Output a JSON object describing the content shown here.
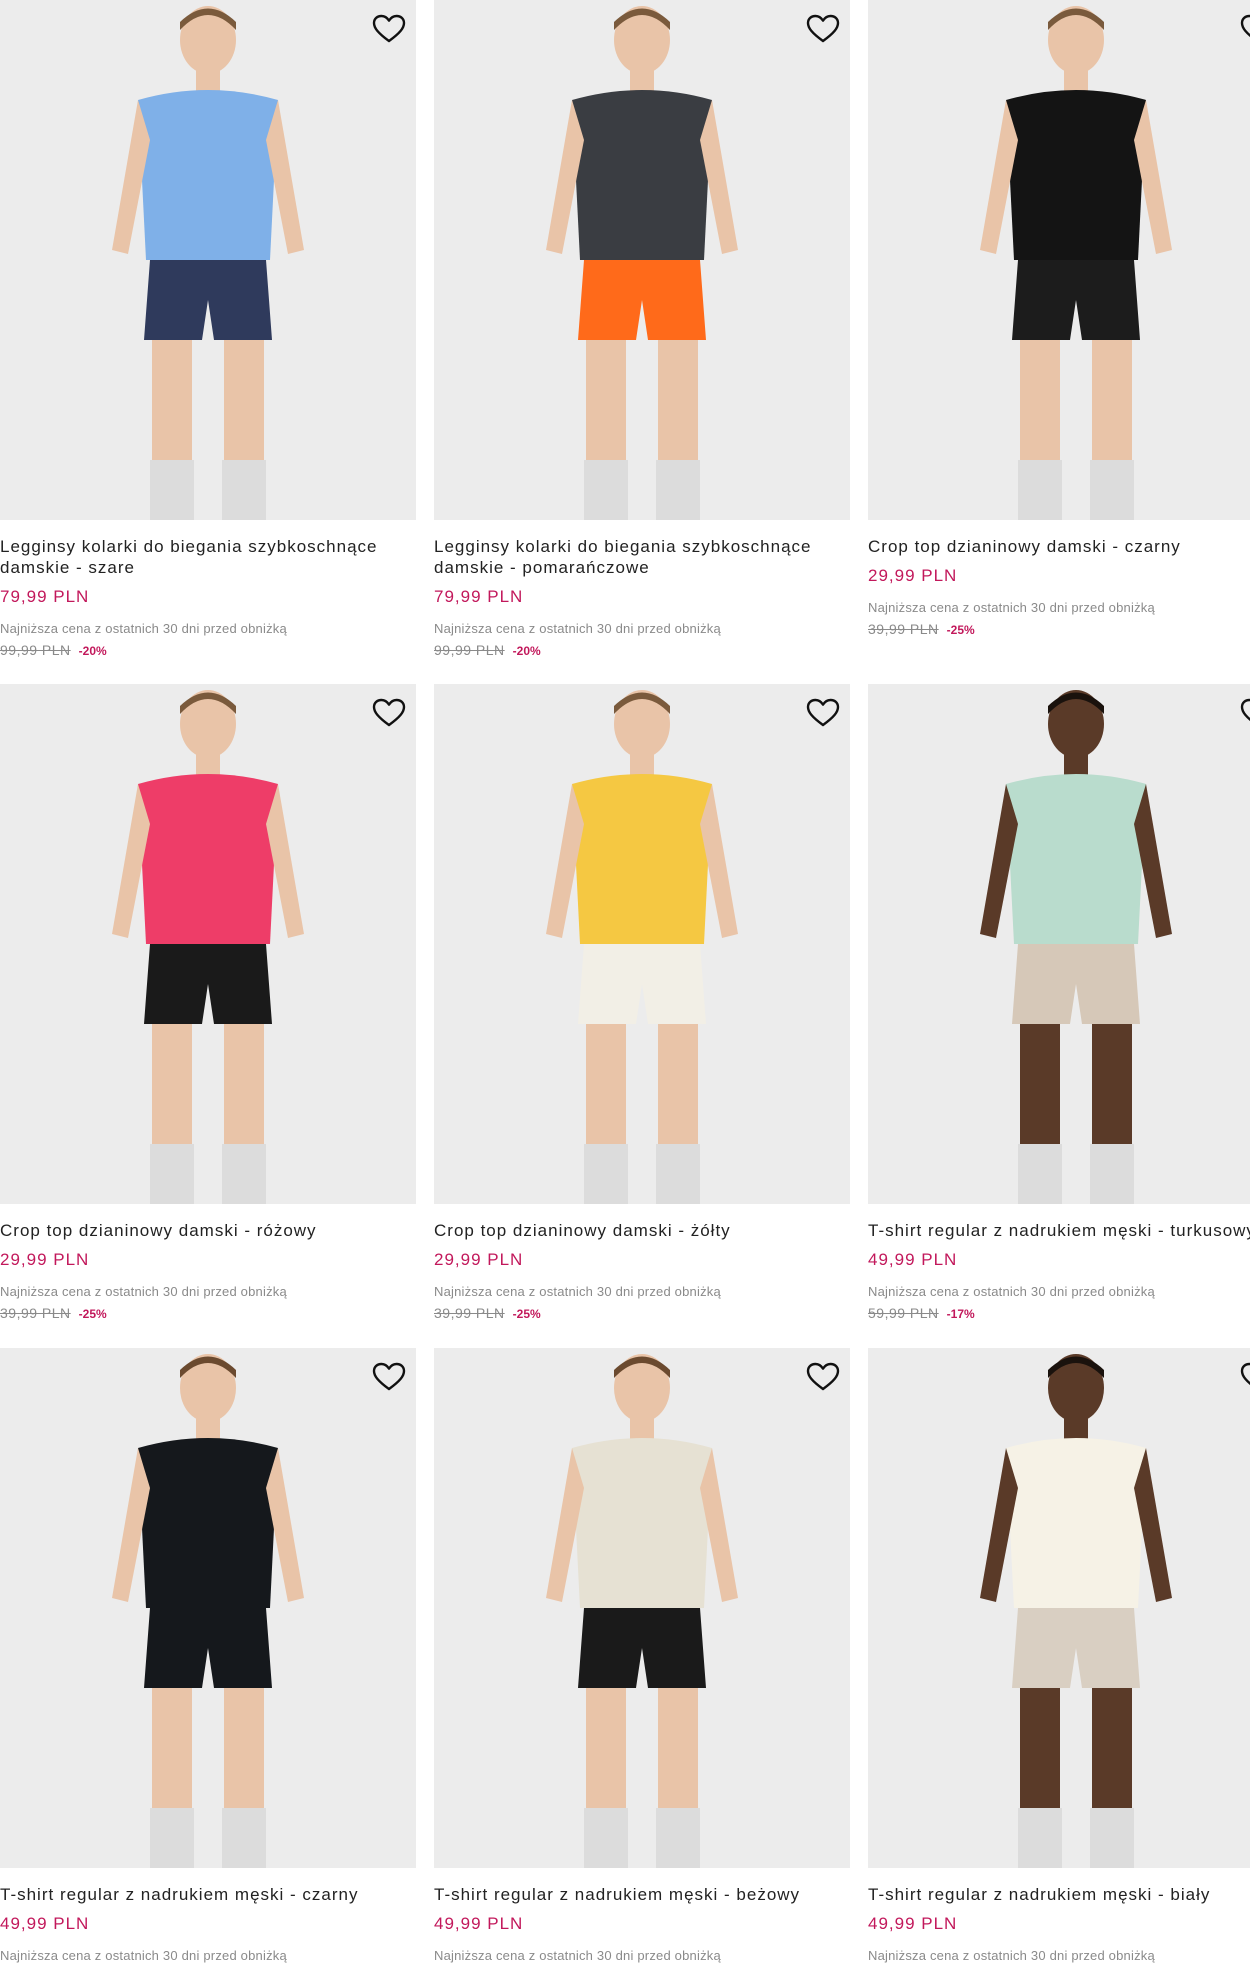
{
  "products": [
    {
      "title": "Legginsy kolarki do biegania szybkoschnące damskie - szare",
      "price": "79,99 PLN",
      "note": "Najniższa cena z ostatnich 30 dni przed obniżką",
      "old_price": "99,99 PLN",
      "discount": "-20%",
      "colors": {
        "top": "#7fb0e8",
        "bottom": "#2f3a5c"
      }
    },
    {
      "title": "Legginsy kolarki do biegania szybkoschnące damskie - pomarańczowe",
      "price": "79,99 PLN",
      "note": "Najniższa cena z ostatnich 30 dni przed obniżką",
      "old_price": "99,99 PLN",
      "discount": "-20%",
      "colors": {
        "top": "#3a3d42",
        "bottom": "#ff6a1a"
      }
    },
    {
      "title": "Crop top dzianinowy damski - czarny",
      "price": "29,99 PLN",
      "note": "Najniższa cena z ostatnich 30 dni przed obniżką",
      "old_price": "39,99 PLN",
      "discount": "-25%",
      "colors": {
        "top": "#141414",
        "bottom": "#1c1c1c"
      }
    },
    {
      "title": "Crop top dzianinowy damski - różowy",
      "price": "29,99 PLN",
      "note": "Najniższa cena z ostatnich 30 dni przed obniżką",
      "old_price": "39,99 PLN",
      "discount": "-25%",
      "colors": {
        "top": "#ee3d68",
        "bottom": "#1a1a1a"
      }
    },
    {
      "title": "Crop top dzianinowy damski - żółty",
      "price": "29,99 PLN",
      "note": "Najniższa cena z ostatnich 30 dni przed obniżką",
      "old_price": "39,99 PLN",
      "discount": "-25%",
      "colors": {
        "top": "#f5c842",
        "bottom": "#f2efe6"
      }
    },
    {
      "title": "T-shirt regular z nadrukiem męski - turkusowy",
      "price": "49,99 PLN",
      "note": "Najniższa cena z ostatnich 30 dni przed obniżką",
      "old_price": "59,99 PLN",
      "discount": "-17%",
      "colors": {
        "top": "#b9dccd",
        "bottom": "#d6c8b8"
      }
    },
    {
      "title": "T-shirt regular z nadrukiem męski - czarny",
      "price": "49,99 PLN",
      "note": "Najniższa cena z ostatnich 30 dni przed obniżką",
      "old_price": "",
      "discount": "",
      "colors": {
        "top": "#15181c",
        "bottom": "#15181c"
      }
    },
    {
      "title": "T-shirt regular z nadrukiem męski - beżowy",
      "price": "49,99 PLN",
      "note": "Najniższa cena z ostatnich 30 dni przed obniżką",
      "old_price": "",
      "discount": "",
      "colors": {
        "top": "#e6e1d3",
        "bottom": "#1a1a1a"
      }
    },
    {
      "title": "T-shirt regular z nadrukiem męski - biały",
      "price": "49,99 PLN",
      "note": "Najniższa cena z ostatnich 30 dni przed obniżką",
      "old_price": "",
      "discount": "",
      "colors": {
        "top": "#f6f2e6",
        "bottom": "#d9cfc2"
      }
    }
  ],
  "icons": {
    "wishlist": "heart-outline-icon"
  }
}
